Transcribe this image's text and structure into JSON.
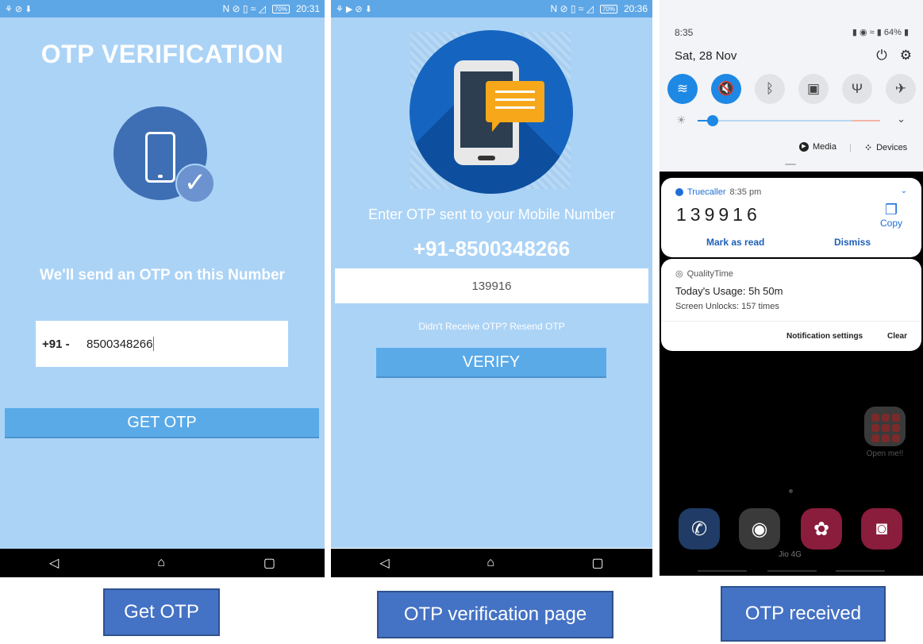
{
  "panel1": {
    "status": {
      "left_icons": "⚘ ⊘ ⬇",
      "right_icons": "N ⊘ ▯ ≈ ◿",
      "battery": "70%",
      "time": "20:31"
    },
    "title": "OTP VERIFICATION",
    "subtitle": "We'll send an OTP on this Number",
    "country_code": "+91 -",
    "phone_value": "8500348266",
    "button_label": "GET OTP",
    "caption": "Get OTP"
  },
  "panel2": {
    "status": {
      "left_icons": "⚘ ▶ ⊘ ⬇",
      "right_icons": "N ⊘ ▯ ≈ ◿",
      "battery": "70%",
      "time": "20:36"
    },
    "subtitle": "Enter OTP sent to your Mobile Number",
    "phone_number": "+91-8500348266",
    "otp_value": "139916",
    "resend_text": "Didn't Receive OTP? Resend OTP",
    "button_label": "VERIFY",
    "caption": "OTP verification page"
  },
  "panel3": {
    "time": "8:35",
    "status_right": "64%",
    "date": "Sat, 28 Nov",
    "media_label": "Media",
    "devices_label": "Devices",
    "notif1": {
      "app": "Truecaller",
      "time": "8:35 pm",
      "code": "139916",
      "copy_label": "Copy",
      "action1": "Mark as read",
      "action2": "Dismiss"
    },
    "notif2": {
      "app": "QualityTime",
      "line1": "Today's Usage: 5h 50m",
      "line2": "Screen Unlocks: 157 times",
      "settings": "Notification settings",
      "clear": "Clear"
    },
    "folder_label": "Open me!!",
    "carrier": "Jio 4G",
    "caption": "OTP received"
  },
  "colors": {
    "accent": "#5aaae8",
    "background": "#abd3f6",
    "caption_bg": "#4472c4",
    "toggle_on": "#1e88e5"
  }
}
